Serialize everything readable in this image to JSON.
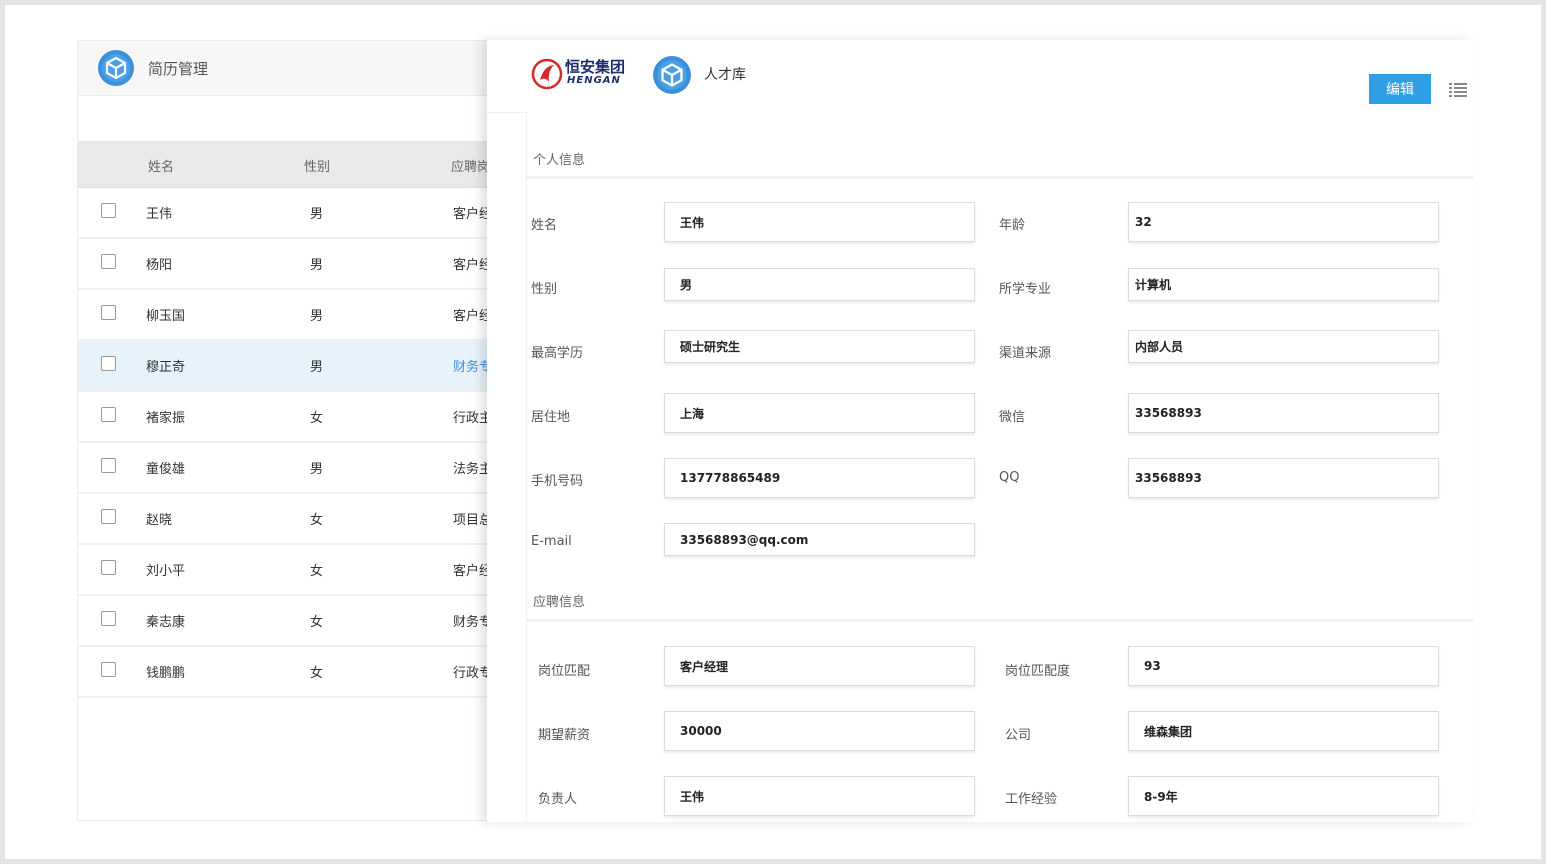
{
  "resume_list": {
    "title": "简历管理",
    "columns": {
      "name": "姓名",
      "gender": "性别",
      "position": "应聘岗"
    },
    "rows": [
      {
        "name": "王伟",
        "gender": "男",
        "position": "客户经"
      },
      {
        "name": "杨阳",
        "gender": "男",
        "position": "客户经"
      },
      {
        "name": "柳玉国",
        "gender": "男",
        "position": "客户经"
      },
      {
        "name": "穆正奇",
        "gender": "男",
        "position": "财务专"
      },
      {
        "name": "褚家振",
        "gender": "女",
        "position": "行政主"
      },
      {
        "name": "童俊雄",
        "gender": "男",
        "position": "法务主"
      },
      {
        "name": "赵晓",
        "gender": "女",
        "position": "项目总"
      },
      {
        "name": "刘小平",
        "gender": "女",
        "position": "客户经"
      },
      {
        "name": "秦志康",
        "gender": "女",
        "position": "财务专"
      },
      {
        "name": "钱鹏鹏",
        "gender": "女",
        "position": "行政专"
      }
    ],
    "selected_row": 3
  },
  "detail": {
    "brand": {
      "name_cn": "恒安集团",
      "name_en": "HENGAN"
    },
    "app_title": "人才库",
    "edit_label": "编辑",
    "personal": {
      "title": "个人信息",
      "name_label": "姓名",
      "name_value": "王伟",
      "age_label": "年龄",
      "age_value": "32",
      "gender_label": "性别",
      "gender_value": "男",
      "major_label": "所学专业",
      "major_value": "计算机",
      "edu_label": "最高学历",
      "edu_value": "硕士研究生",
      "channel_label": "渠道来源",
      "channel_value": "内部人员",
      "residence_label": "居住地",
      "residence_value": "上海",
      "wechat_label": "微信",
      "wechat_value": "33568893",
      "phone_label": "手机号码",
      "phone_value": "137778865489",
      "qq_label": "QQ",
      "qq_value": "33568893",
      "email_label": "E-mail",
      "email_value": "33568893@qq.com"
    },
    "application": {
      "title": "应聘信息",
      "position_label": "岗位匹配",
      "position_value": "客户经理",
      "match_label": "岗位匹配度",
      "match_value": "93",
      "salary_label": "期望薪资",
      "salary_value": "30000",
      "company_label": "公司",
      "company_value": "维森集团",
      "owner_label": "负责人",
      "owner_value": "王伟",
      "experience_label": "工作经验",
      "experience_value": "8-9年"
    }
  },
  "colors": {
    "accent": "#2fa0e6",
    "selected_row": "#e6f3fb",
    "brand_red": "#d62a2a",
    "brand_navy": "#1f2d6e"
  }
}
